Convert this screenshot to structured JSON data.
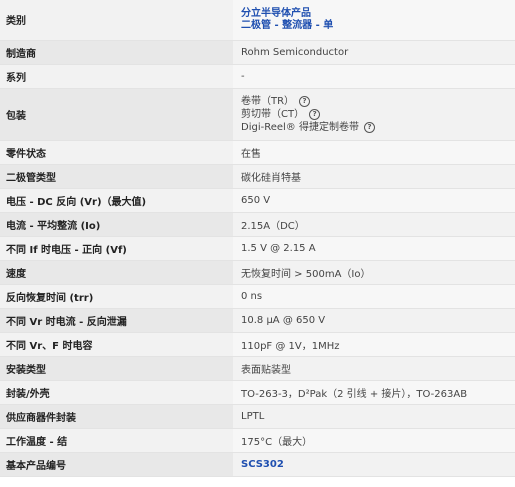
{
  "rows": [
    {
      "label": "类别",
      "lines": [
        "分立半导体产品",
        "二极管 - 整流器 - 单"
      ],
      "type": "link"
    },
    {
      "label": "制造商",
      "value": "Rohm Semiconductor"
    },
    {
      "label": "系列",
      "value": "-"
    },
    {
      "label": "包装",
      "packaging": [
        "卷带（TR）",
        "剪切带（CT）",
        "Digi-Reel® 得捷定制卷带"
      ],
      "type": "packaging"
    },
    {
      "label": "零件状态",
      "value": "在售"
    },
    {
      "label": "二极管类型",
      "value": "碳化硅肖特基"
    },
    {
      "label": "电压 - DC 反向 (Vr)（最大值)",
      "value": "650 V"
    },
    {
      "label": "电流 - 平均整流 (Io)",
      "value": "2.15A（DC）"
    },
    {
      "label": "不同 If 时电压 - 正向 (Vf)",
      "value": "1.5 V @ 2.15 A"
    },
    {
      "label": "速度",
      "value": "无恢复时间 > 500mA（Io）"
    },
    {
      "label": "反向恢复时间 (trr)",
      "value": "0 ns"
    },
    {
      "label": "不同 Vr 时电流 - 反向泄漏",
      "value": "10.8 µA @ 650 V"
    },
    {
      "label": "不同 Vr、F 时电容",
      "value": "110pF @ 1V，1MHz"
    },
    {
      "label": "安装类型",
      "value": "表面贴装型"
    },
    {
      "label": "封装/外壳",
      "value": "TO-263-3，D²Pak（2 引线 + 接片），TO-263AB"
    },
    {
      "label": "供应商器件封装",
      "value": "LPTL"
    },
    {
      "label": "工作温度 - 结",
      "value": "175°C（最大）"
    },
    {
      "label": "基本产品编号",
      "value": "SCS302",
      "type": "link"
    }
  ],
  "icons": {
    "help": "question-circle-icon"
  }
}
